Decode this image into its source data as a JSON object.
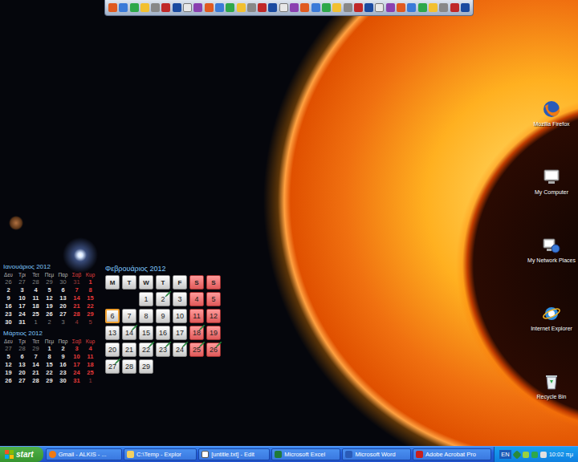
{
  "small_calendars": [
    {
      "title": "Ιανουάριος 2012",
      "headers": [
        {
          "label": "Δευ",
          "weekend": false
        },
        {
          "label": "Τρι",
          "weekend": false
        },
        {
          "label": "Τετ",
          "weekend": false
        },
        {
          "label": "Πεμ",
          "weekend": false
        },
        {
          "label": "Παρ",
          "weekend": false
        },
        {
          "label": "Σαβ",
          "weekend": true
        },
        {
          "label": "Κυρ",
          "weekend": true
        }
      ],
      "weeks": [
        [
          {
            "d": "26",
            "other": true
          },
          {
            "d": "27",
            "other": true
          },
          {
            "d": "28",
            "other": true
          },
          {
            "d": "29",
            "other": true
          },
          {
            "d": "30",
            "other": true
          },
          {
            "d": "31",
            "other": true
          },
          {
            "d": "1",
            "other": false
          }
        ],
        [
          {
            "d": "2",
            "other": false
          },
          {
            "d": "3",
            "other": false
          },
          {
            "d": "4",
            "other": false
          },
          {
            "d": "5",
            "other": false
          },
          {
            "d": "6",
            "other": false
          },
          {
            "d": "7",
            "other": false
          },
          {
            "d": "8",
            "other": false
          }
        ],
        [
          {
            "d": "9",
            "other": false
          },
          {
            "d": "10",
            "other": false
          },
          {
            "d": "11",
            "other": false
          },
          {
            "d": "12",
            "other": false
          },
          {
            "d": "13",
            "other": false
          },
          {
            "d": "14",
            "other": false
          },
          {
            "d": "15",
            "other": false
          }
        ],
        [
          {
            "d": "16",
            "other": false
          },
          {
            "d": "17",
            "other": false
          },
          {
            "d": "18",
            "other": false
          },
          {
            "d": "19",
            "other": false
          },
          {
            "d": "20",
            "other": false
          },
          {
            "d": "21",
            "other": false
          },
          {
            "d": "22",
            "other": false
          }
        ],
        [
          {
            "d": "23",
            "other": false
          },
          {
            "d": "24",
            "other": false
          },
          {
            "d": "25",
            "other": false
          },
          {
            "d": "26",
            "other": false
          },
          {
            "d": "27",
            "other": false
          },
          {
            "d": "28",
            "other": false
          },
          {
            "d": "29",
            "other": false
          }
        ],
        [
          {
            "d": "30",
            "other": false
          },
          {
            "d": "31",
            "other": false
          },
          {
            "d": "1",
            "other": true
          },
          {
            "d": "2",
            "other": true
          },
          {
            "d": "3",
            "other": true
          },
          {
            "d": "4",
            "other": true
          },
          {
            "d": "5",
            "other": true
          }
        ]
      ]
    },
    {
      "title": "Μάρτιος 2012",
      "headers": [
        {
          "label": "Δευ",
          "weekend": false
        },
        {
          "label": "Τρι",
          "weekend": false
        },
        {
          "label": "Τετ",
          "weekend": false
        },
        {
          "label": "Πεμ",
          "weekend": false
        },
        {
          "label": "Παρ",
          "weekend": false
        },
        {
          "label": "Σαβ",
          "weekend": true
        },
        {
          "label": "Κυρ",
          "weekend": true
        }
      ],
      "weeks": [
        [
          {
            "d": "27",
            "other": true
          },
          {
            "d": "28",
            "other": true
          },
          {
            "d": "29",
            "other": true
          },
          {
            "d": "1",
            "other": false
          },
          {
            "d": "2",
            "other": false
          },
          {
            "d": "3",
            "other": false
          },
          {
            "d": "4",
            "other": false
          }
        ],
        [
          {
            "d": "5",
            "other": false
          },
          {
            "d": "6",
            "other": false
          },
          {
            "d": "7",
            "other": false
          },
          {
            "d": "8",
            "other": false
          },
          {
            "d": "9",
            "other": false
          },
          {
            "d": "10",
            "other": false
          },
          {
            "d": "11",
            "other": false
          }
        ],
        [
          {
            "d": "12",
            "other": false
          },
          {
            "d": "13",
            "other": false
          },
          {
            "d": "14",
            "other": false
          },
          {
            "d": "15",
            "other": false
          },
          {
            "d": "16",
            "other": false
          },
          {
            "d": "17",
            "other": false
          },
          {
            "d": "18",
            "other": false
          }
        ],
        [
          {
            "d": "19",
            "other": false
          },
          {
            "d": "20",
            "other": false
          },
          {
            "d": "21",
            "other": false
          },
          {
            "d": "22",
            "other": false
          },
          {
            "d": "23",
            "other": false
          },
          {
            "d": "24",
            "other": false
          },
          {
            "d": "25",
            "other": false
          }
        ],
        [
          {
            "d": "26",
            "other": false
          },
          {
            "d": "27",
            "other": false
          },
          {
            "d": "28",
            "other": false
          },
          {
            "d": "29",
            "other": false
          },
          {
            "d": "30",
            "other": false
          },
          {
            "d": "31",
            "other": false
          },
          {
            "d": "1",
            "other": true
          }
        ]
      ]
    }
  ],
  "month_calendar": {
    "title": "Φεβρουάριος 2012",
    "headers": [
      {
        "label": "M",
        "weekend": false
      },
      {
        "label": "T",
        "weekend": false
      },
      {
        "label": "W",
        "weekend": false
      },
      {
        "label": "T",
        "weekend": false
      },
      {
        "label": "F",
        "weekend": false
      },
      {
        "label": "S",
        "weekend": true
      },
      {
        "label": "S",
        "weekend": true
      }
    ],
    "weeks": [
      [
        {
          "d": "",
          "blank": true,
          "event": false,
          "today": false
        },
        {
          "d": "",
          "blank": true,
          "event": false,
          "today": false
        },
        {
          "d": "1",
          "blank": false,
          "event": false,
          "today": false
        },
        {
          "d": "2",
          "blank": false,
          "event": true,
          "today": false
        },
        {
          "d": "3",
          "blank": false,
          "event": false,
          "today": false
        },
        {
          "d": "4",
          "blank": false,
          "event": false,
          "today": false
        },
        {
          "d": "5",
          "blank": false,
          "event": false,
          "today": false
        }
      ],
      [
        {
          "d": "6",
          "blank": false,
          "event": false,
          "today": true
        },
        {
          "d": "7",
          "blank": false,
          "event": false,
          "today": false
        },
        {
          "d": "8",
          "blank": false,
          "event": false,
          "today": false
        },
        {
          "d": "9",
          "blank": false,
          "event": false,
          "today": false
        },
        {
          "d": "10",
          "blank": false,
          "event": false,
          "today": false
        },
        {
          "d": "11",
          "blank": false,
          "event": false,
          "today": false
        },
        {
          "d": "12",
          "blank": false,
          "event": false,
          "today": false
        }
      ],
      [
        {
          "d": "13",
          "blank": false,
          "event": false,
          "today": false
        },
        {
          "d": "14",
          "blank": false,
          "event": true,
          "today": false
        },
        {
          "d": "15",
          "blank": false,
          "event": false,
          "today": false
        },
        {
          "d": "16",
          "blank": false,
          "event": false,
          "today": false
        },
        {
          "d": "17",
          "blank": false,
          "event": false,
          "today": false
        },
        {
          "d": "18",
          "blank": false,
          "event": true,
          "today": false
        },
        {
          "d": "19",
          "blank": false,
          "event": false,
          "today": false
        }
      ],
      [
        {
          "d": "20",
          "blank": false,
          "event": false,
          "today": false
        },
        {
          "d": "21",
          "blank": false,
          "event": false,
          "today": false
        },
        {
          "d": "22",
          "blank": false,
          "event": true,
          "today": false
        },
        {
          "d": "23",
          "blank": false,
          "event": true,
          "today": false
        },
        {
          "d": "24",
          "blank": false,
          "event": true,
          "today": false
        },
        {
          "d": "25",
          "blank": false,
          "event": true,
          "today": false
        },
        {
          "d": "26",
          "blank": false,
          "event": true,
          "today": false
        }
      ],
      [
        {
          "d": "27",
          "blank": false,
          "event": true,
          "today": false
        },
        {
          "d": "28",
          "blank": false,
          "event": false,
          "today": false
        },
        {
          "d": "29",
          "blank": false,
          "event": false,
          "today": false
        }
      ]
    ]
  },
  "desktop_icons": [
    {
      "label": "Mozilla Firefox",
      "kind": "firefox"
    },
    {
      "label": "My Computer",
      "kind": "computer"
    },
    {
      "label": "My Network Places",
      "kind": "network"
    },
    {
      "label": "Internet Explorer",
      "kind": "ie"
    },
    {
      "label": "Recycle Bin",
      "kind": "recycle"
    }
  ],
  "taskbar": {
    "start": "start",
    "tasks": [
      {
        "label": "Gmail - ALKIS - ...",
        "kind": "firefox"
      },
      {
        "label": "C:\\Temp - Explor",
        "kind": "explorer"
      },
      {
        "label": "[untitle.txt] - Edit",
        "kind": "editor"
      },
      {
        "label": "Microsoft Excel",
        "kind": "excel"
      },
      {
        "label": "Microsoft Word",
        "kind": "word"
      },
      {
        "label": "Adobe Acrobat Pro",
        "kind": "acrobat"
      }
    ],
    "language": "EN",
    "clock": "10:02 πμ"
  }
}
